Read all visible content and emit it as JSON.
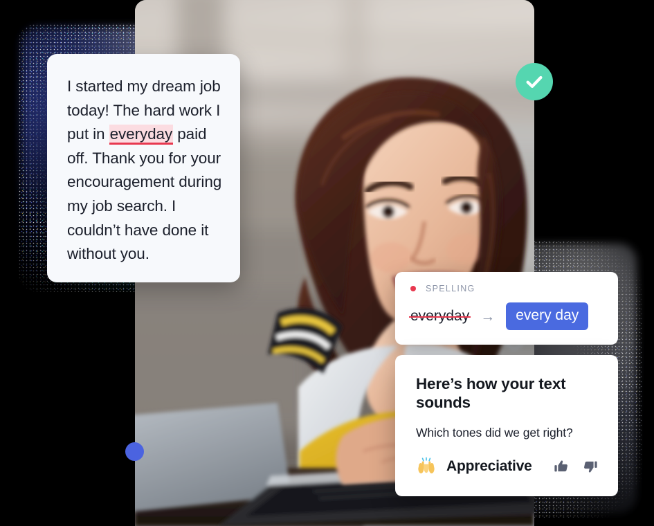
{
  "editor_card": {
    "name": "text-document-card",
    "paragraph_before": "I started my dream job today! The hard work I put in ",
    "highlighted_word": "everyday",
    "paragraph_after": " paid off. Thank you for your encouragement during my job search. I couldn’t have done it without you.",
    "background": "#F7F9FC",
    "highlight_background": "#FBDCE1",
    "highlight_underline": "#E8384F"
  },
  "check_badge": {
    "icon": "check-icon",
    "color": "#55D6B0"
  },
  "blue_dot": {
    "color": "#4B63E0"
  },
  "spelling_card": {
    "category_label": "SPELLING",
    "dot_color": "#E8384F",
    "original_word": "everyday",
    "arrow": "→",
    "suggestion": "every day",
    "suggestion_color": "#4A6AE0"
  },
  "tone_card": {
    "title": "Here’s how your text sounds",
    "question": "Which tones did we get right?",
    "tone_emoji": "raising-hands-emoji",
    "tone_name": "Appreciative",
    "thumbs_up_icon": "thumbs-up-icon",
    "thumbs_down_icon": "thumbs-down-icon",
    "thumb_color": "#5A6072"
  },
  "photo": {
    "alt": "smiling-woman-at-laptop-photo"
  }
}
